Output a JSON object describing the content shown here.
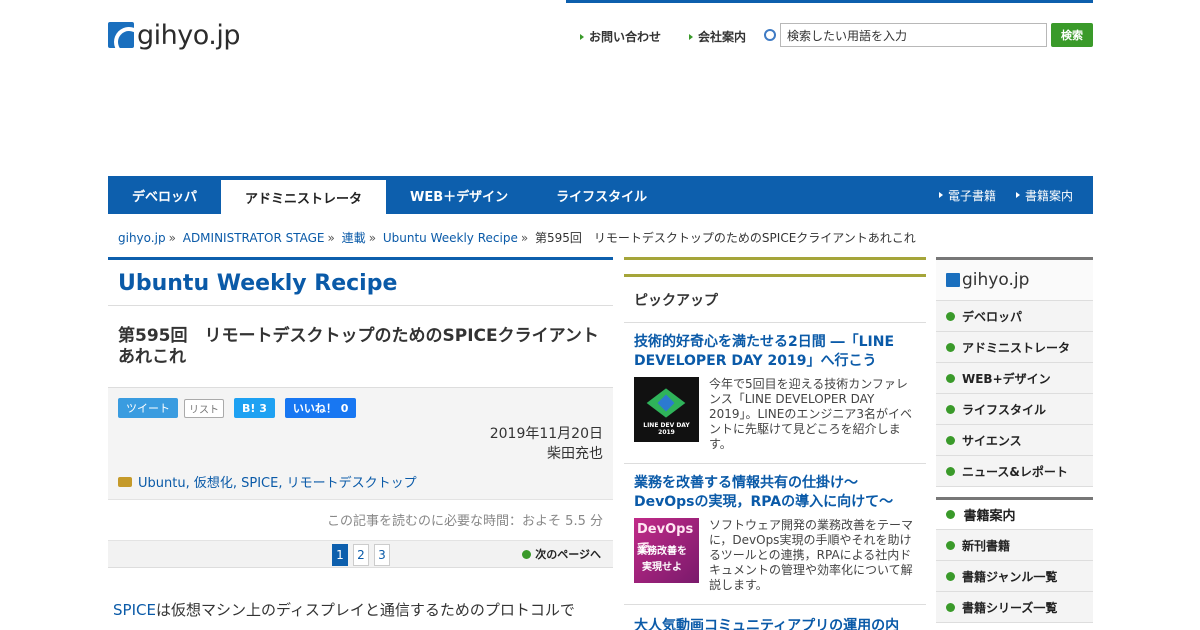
{
  "logo": {
    "text": "gihyo.jp"
  },
  "header": {
    "links": [
      "お問い合わせ",
      "会社案内"
    ],
    "search_placeholder": "検索したい用語を入力",
    "search_button": "検索"
  },
  "nav": {
    "tabs": [
      "デベロッパ",
      "アドミニストレータ",
      "WEB＋デザイン",
      "ライフスタイル"
    ],
    "right": [
      "電子書籍",
      "書籍案内"
    ]
  },
  "breadcrumb": [
    "gihyo.jp",
    "ADMINISTRATOR STAGE",
    "連載",
    "Ubuntu Weekly Recipe",
    "第595回　リモートデスクトップのためのSPICEクライアントあれこれ"
  ],
  "article": {
    "series": "Ubuntu Weekly Recipe",
    "title": "第595回　リモートデスクトップのためのSPICEクライアントあれこれ",
    "tweet": "ツイート",
    "list": "リスト",
    "hatena": "B! 3",
    "like": "いいね！ 0",
    "date": "2019年11月20日",
    "author": "柴田充也",
    "tags": "Ubuntu, 仮想化, SPICE, リモートデスクトップ",
    "read_time": "この記事を読むのに必要な時間：およそ 5.5 分",
    "pages": [
      "1",
      "2",
      "3"
    ],
    "next_page": "次のページへ",
    "body_link": "SPICE",
    "body": "は仮想マシン上のディスプレイと通信するためのプロトコルで"
  },
  "pickup": {
    "header": "ピックアップ",
    "items": [
      {
        "title": "技術的好奇心を満たせる2日間 ―「LINE DEVELOPER DAY 2019」へ行こう",
        "text": "今年で5回目を迎える技術カンファレンス「LINE DEVELOPER DAY 2019」。LINEのエンジニア3名がイベントに先駆けて見どころを紹介します。",
        "thumb_label": "LINE DEV DAY 2019"
      },
      {
        "title": "業務を改善する情報共有の仕掛け～DevOpsの実現，RPAの導入に向けて～",
        "text": "ソフトウェア開発の業務改善をテーマに，DevOps実現の手順やそれを助けるツールとの連携，RPAによる社内ドキュメントの管理や効率化について解説します。",
        "thumb_lines": [
          "DevOpsで",
          "業務改善を",
          "実現せよ"
        ]
      }
    ],
    "third_partial": "大人気動画コミュニティアプリの運用の内"
  },
  "sidebar": {
    "logo": "gihyo.jp",
    "items": [
      "デベロッパ",
      "アドミニストレータ",
      "WEB+デザイン",
      "ライフスタイル",
      "サイエンス",
      "ニュース&レポート"
    ],
    "books_header": "書籍案内",
    "books": [
      "新刊書籍",
      "書籍ジャンル一覧",
      "書籍シリーズ一覧"
    ]
  }
}
